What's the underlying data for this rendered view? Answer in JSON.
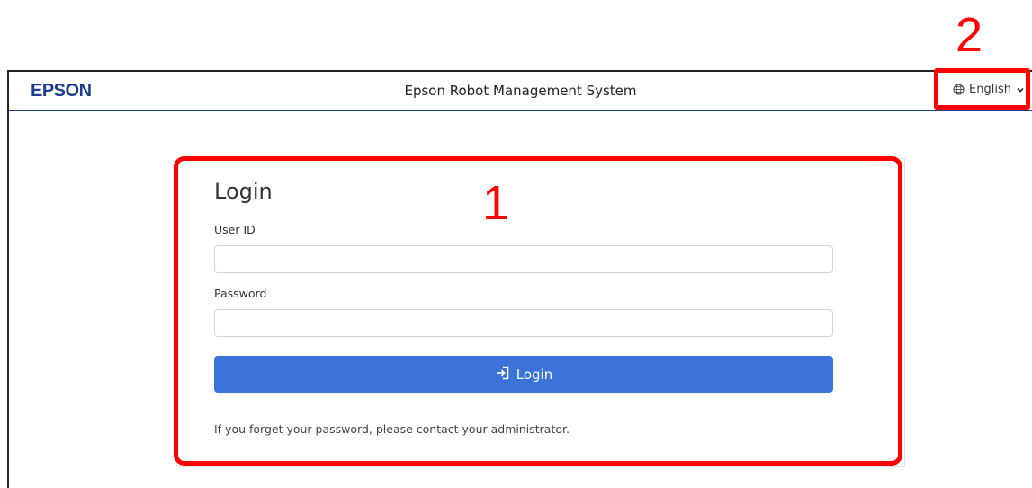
{
  "header": {
    "logo": "EPSON",
    "title": "Epson Robot Management System",
    "language": {
      "icon": "globe-icon",
      "selected": "English",
      "chevron": "chevron-down-icon"
    }
  },
  "login": {
    "title": "Login",
    "user_id_label": "User ID",
    "user_id_value": "",
    "password_label": "Password",
    "password_value": "",
    "button_label": "Login",
    "button_icon": "login-icon",
    "note": "If you forget your password, please contact your administrator."
  },
  "annotations": {
    "callout_1": "1",
    "callout_2": "2",
    "color": "#ff0000"
  },
  "colors": {
    "brand": "#1b3c90",
    "accent": "#3b73db"
  }
}
